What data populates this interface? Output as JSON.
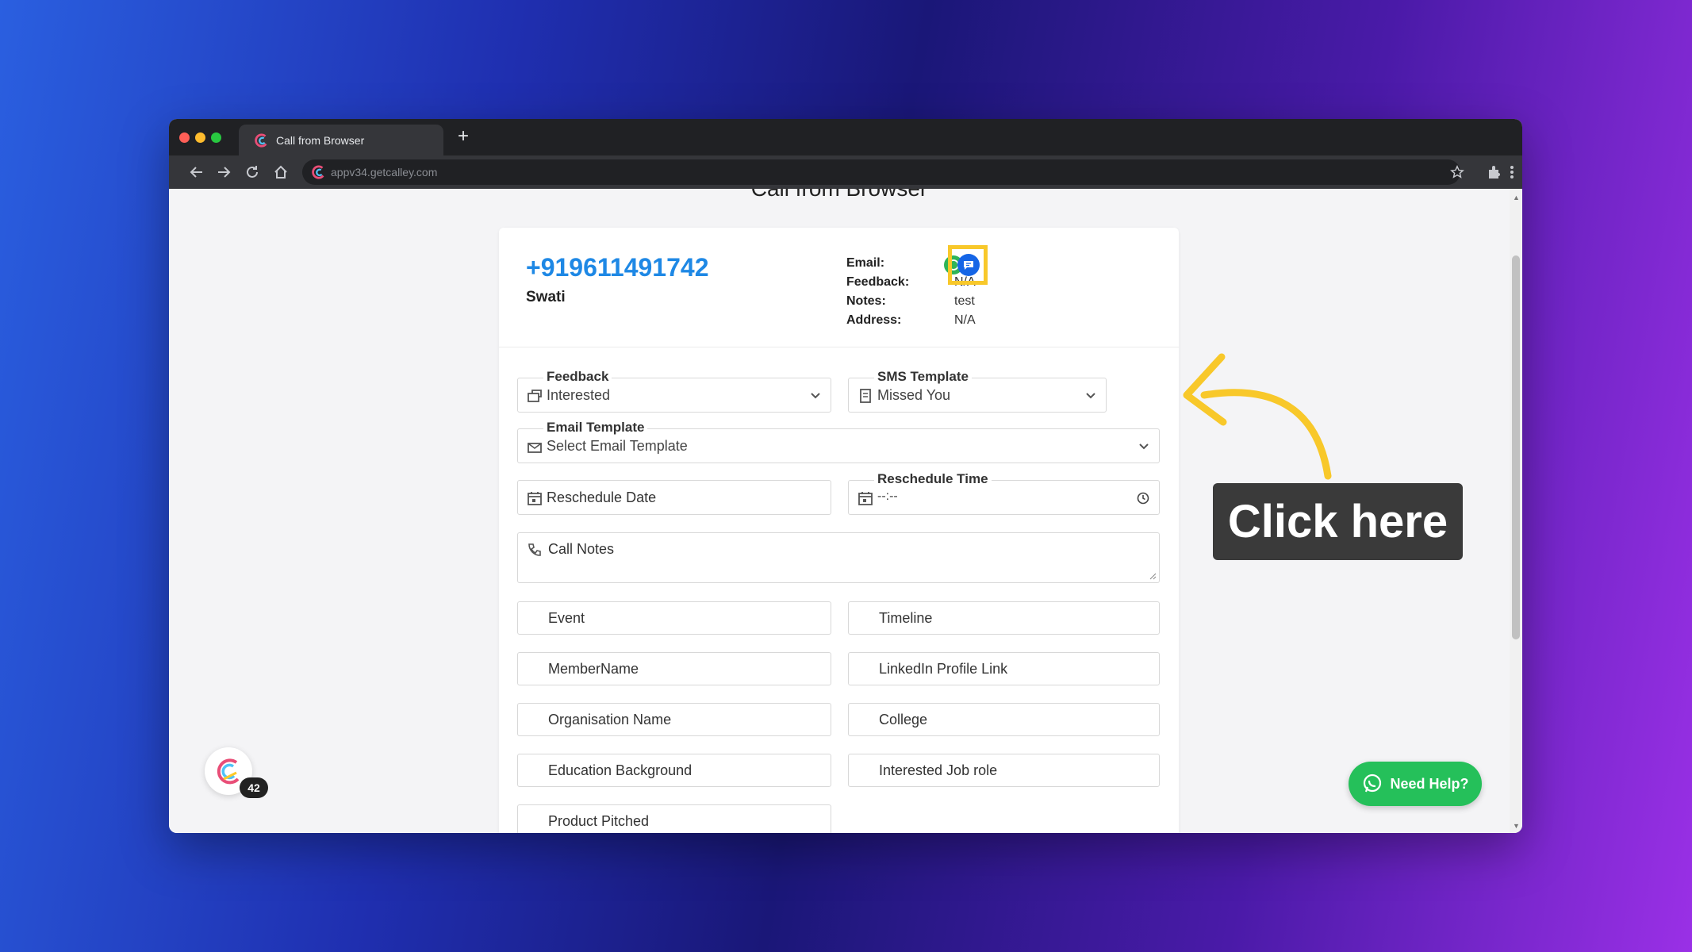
{
  "browser": {
    "tab_title": "Call from Browser",
    "url": "appv34.getcalley.com",
    "new_tab_symbol": "+"
  },
  "page": {
    "title": "Call from Browser"
  },
  "contact": {
    "phone": "+919611491742",
    "name": "Swati",
    "info": [
      {
        "label": "Email:",
        "value": ""
      },
      {
        "label": "Feedback:",
        "value": "N/A"
      },
      {
        "label": "Notes:",
        "value": "test"
      },
      {
        "label": "Address:",
        "value": "N/A"
      }
    ]
  },
  "form": {
    "feedback": {
      "label": "Feedback",
      "value": "Interested"
    },
    "sms_template": {
      "label": "SMS Template",
      "value": "Missed You"
    },
    "email_template": {
      "label": "Email Template",
      "value": "Select Email Template"
    },
    "reschedule_date": {
      "placeholder": "Reschedule Date"
    },
    "reschedule_time": {
      "label": "Reschedule Time",
      "value": "--:--"
    },
    "call_notes": {
      "placeholder": "Call Notes"
    },
    "fields": [
      {
        "label": "Event"
      },
      {
        "label": "Timeline"
      },
      {
        "label": "MemberName"
      },
      {
        "label": "LinkedIn Profile Link"
      },
      {
        "label": "Organisation Name"
      },
      {
        "label": "College"
      },
      {
        "label": "Education Background"
      },
      {
        "label": "Interested Job role"
      },
      {
        "label": "Product Pitched"
      }
    ]
  },
  "callout": {
    "text": "Click here"
  },
  "help": {
    "label": "Need Help?"
  },
  "floating": {
    "badge_count": "42"
  },
  "colors": {
    "phone": "#1e88e5",
    "highlight": "#f8c82a",
    "sms_button": "#1565e6",
    "whatsapp": "#25c05a"
  },
  "icons": [
    "feedback-icon",
    "sms-template-icon",
    "email-template-icon",
    "calendar-icon",
    "clock-icon",
    "call-notes-icon",
    "whatsapp-icon",
    "sms-send-icon",
    "chevron-down-icon",
    "back-icon",
    "forward-icon",
    "reload-icon",
    "home-icon",
    "star-icon",
    "extensions-icon",
    "menu-icon"
  ]
}
